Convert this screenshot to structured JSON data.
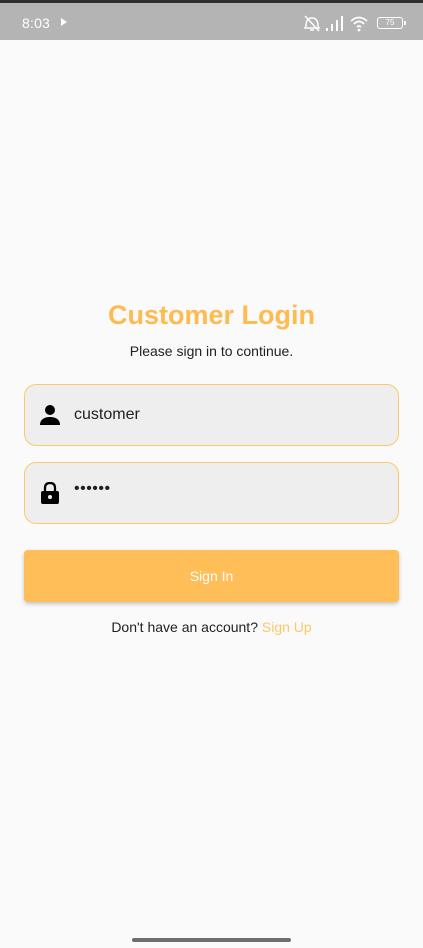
{
  "status_bar": {
    "time": "8:03",
    "battery": "75"
  },
  "login": {
    "title": "Customer Login",
    "subtitle": "Please sign in to continue.",
    "username_value": "customer",
    "password_value": "••••••",
    "sign_in_label": "Sign In",
    "signup_prompt": "Don't have an account?",
    "signup_link": "Sign Up"
  },
  "colors": {
    "accent": "#ffba51",
    "button": "#ffbe57",
    "field_border": "#ffc866",
    "field_background": "#eeeeee",
    "status_bar": "#b4b4b4"
  },
  "icons": {
    "username": "person-icon",
    "password": "lock-icon",
    "status": [
      "play-icon",
      "muted-alarm-icon",
      "signal-icon",
      "wifi-icon",
      "battery-icon"
    ]
  }
}
